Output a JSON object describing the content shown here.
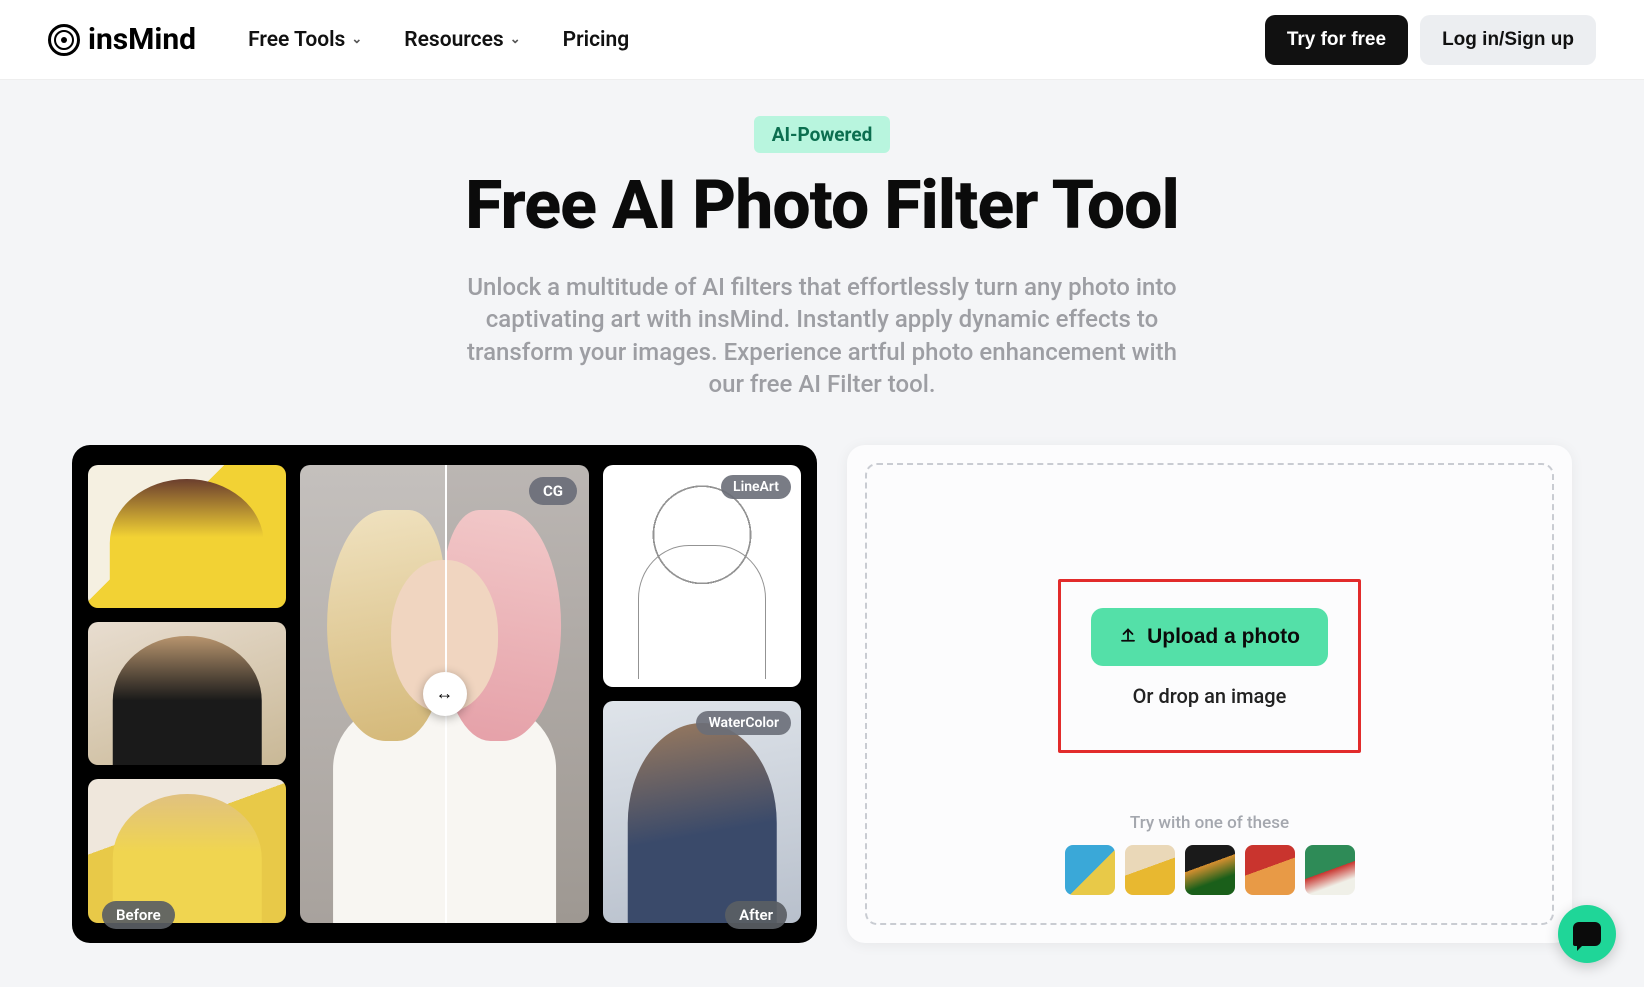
{
  "brand": "insMind",
  "nav": {
    "free_tools": "Free Tools",
    "resources": "Resources",
    "pricing": "Pricing"
  },
  "header_buttons": {
    "try": "Try for free",
    "login": "Log in/Sign up"
  },
  "hero": {
    "pill": "AI-Powered",
    "title": "Free AI Photo Filter Tool",
    "subtitle": "Unlock a multitude of AI filters that effortlessly turn any photo into captivating art with insMind. Instantly apply dynamic effects to transform your images. Experience artful photo enhancement with our free AI Filter tool."
  },
  "showcase": {
    "before": "Before",
    "after": "After",
    "cg_tag": "CG",
    "lineart_tag": "LineArt",
    "watercolor_tag": "WaterColor"
  },
  "upload": {
    "button": "Upload a photo",
    "drop": "Or drop an image",
    "try_label": "Try with one of these"
  }
}
